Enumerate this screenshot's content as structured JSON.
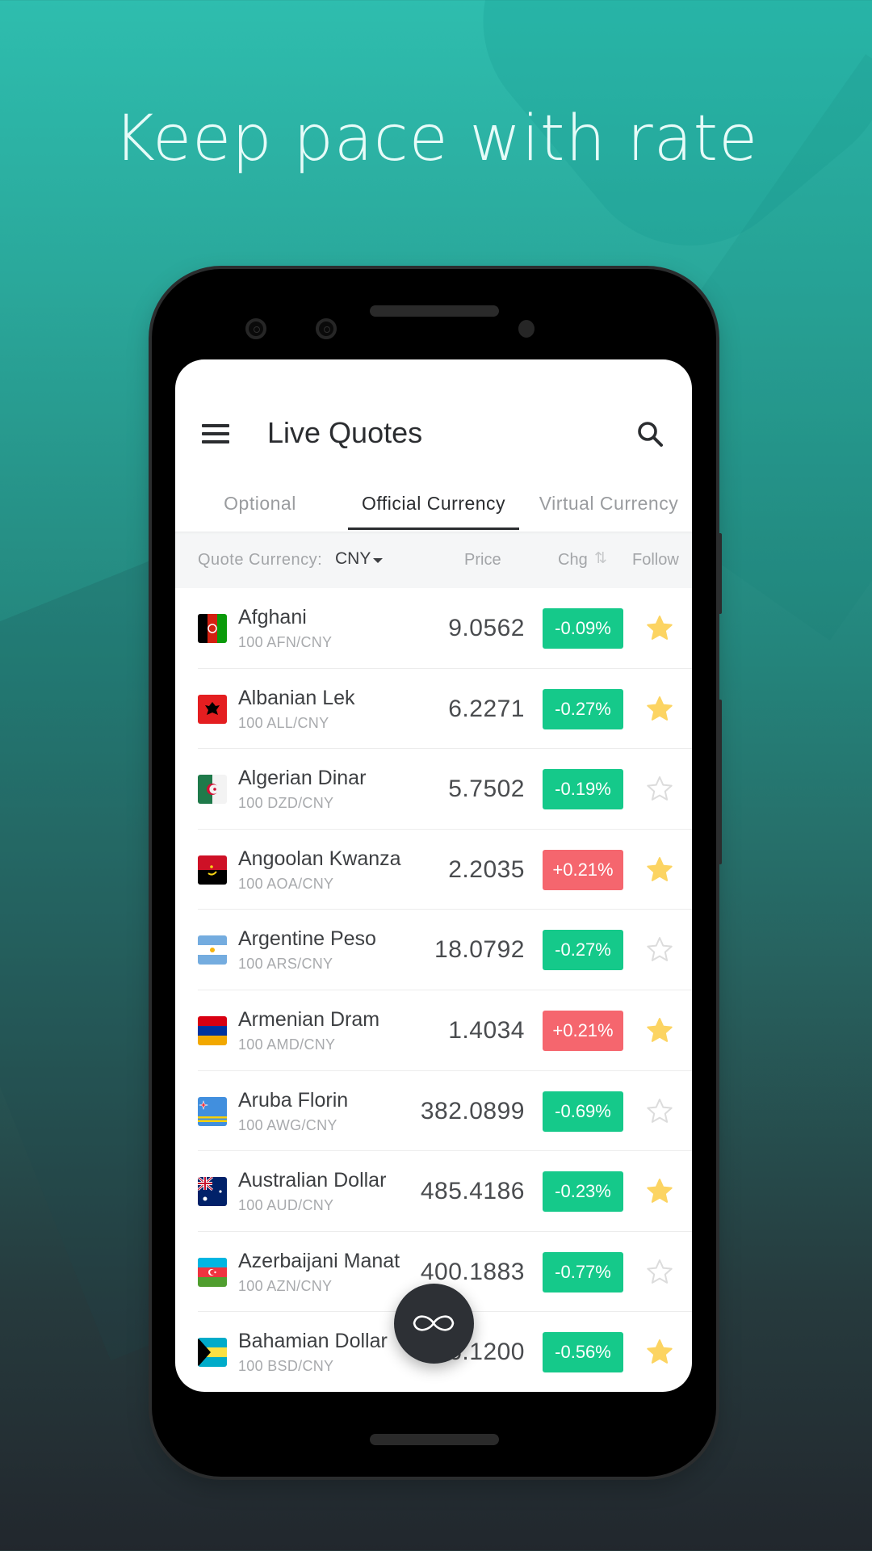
{
  "promo": {
    "headline": "Keep pace with rate"
  },
  "app": {
    "title": "Live Quotes",
    "menu_icon": "hamburger-menu-icon",
    "search_icon": "search-icon"
  },
  "tabs": [
    {
      "label": "Optional",
      "active": false
    },
    {
      "label": "Official Currency",
      "active": true
    },
    {
      "label": "Virtual Currency",
      "active": false
    }
  ],
  "list_header": {
    "quote_currency_label": "Quote Currency:",
    "quote_currency_value": "CNY",
    "price_label": "Price",
    "chg_label": "Chg",
    "sort_icon": "⇅",
    "follow_label": "Follow"
  },
  "colors": {
    "down": "#15c98a",
    "up": "#f5666e",
    "star_on": "#fcd462",
    "star_off": "#dcdcdc"
  },
  "rows": [
    {
      "name": "Afghani",
      "pair": "100 AFN/CNY",
      "price": "9.0562",
      "chg": "-0.09%",
      "direction": "down",
      "followed": true,
      "flag": "af"
    },
    {
      "name": "Albanian Lek",
      "pair": "100 ALL/CNY",
      "price": "6.2271",
      "chg": "-0.27%",
      "direction": "down",
      "followed": true,
      "flag": "al"
    },
    {
      "name": "Algerian Dinar",
      "pair": "100 DZD/CNY",
      "price": "5.7502",
      "chg": "-0.19%",
      "direction": "down",
      "followed": false,
      "flag": "dz"
    },
    {
      "name": "Angoolan Kwanza",
      "pair": "100 AOA/CNY",
      "price": "2.2035",
      "chg": "+0.21%",
      "direction": "up",
      "followed": true,
      "flag": "ao"
    },
    {
      "name": "Argentine Peso",
      "pair": "100 ARS/CNY",
      "price": "18.0792",
      "chg": "-0.27%",
      "direction": "down",
      "followed": false,
      "flag": "ar"
    },
    {
      "name": "Armenian Dram",
      "pair": "100 AMD/CNY",
      "price": "1.4034",
      "chg": "+0.21%",
      "direction": "up",
      "followed": true,
      "flag": "am"
    },
    {
      "name": "Aruba Florin",
      "pair": "100 AWG/CNY",
      "price": "382.0899",
      "chg": "-0.69%",
      "direction": "down",
      "followed": false,
      "flag": "aw"
    },
    {
      "name": "Australian Dollar",
      "pair": "100 AUD/CNY",
      "price": "485.4186",
      "chg": "-0.23%",
      "direction": "down",
      "followed": true,
      "flag": "au"
    },
    {
      "name": "Azerbaijani Manat",
      "pair": "100 AZN/CNY",
      "price": "400.1883",
      "chg": "-0.77%",
      "direction": "down",
      "followed": false,
      "flag": "az"
    },
    {
      "name": "Bahamian Dollar",
      "pair": "100 BSD/CNY",
      "price": "6.1200",
      "chg": "-0.56%",
      "direction": "down",
      "followed": true,
      "flag": "bs"
    }
  ],
  "fab": {
    "icon": "infinity-icon"
  }
}
